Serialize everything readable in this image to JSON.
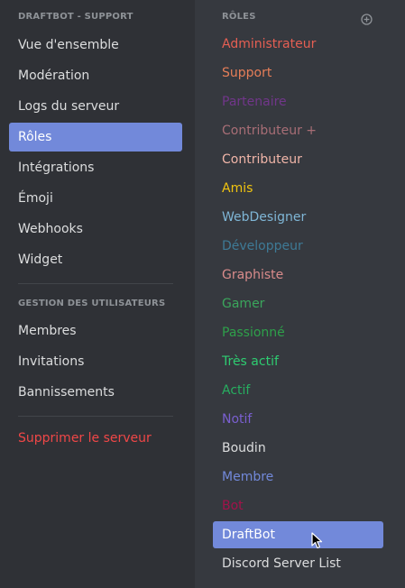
{
  "sidebar": {
    "server_header": "DRAFTBOT - SUPPORT",
    "items": [
      {
        "label": "Vue d'ensemble"
      },
      {
        "label": "Modération"
      },
      {
        "label": "Logs du serveur"
      },
      {
        "label": "Rôles"
      },
      {
        "label": "Intégrations"
      },
      {
        "label": "Émoji"
      },
      {
        "label": "Webhooks"
      },
      {
        "label": "Widget"
      }
    ],
    "users_header": "GESTION DES UTILISATEURS",
    "user_items": [
      {
        "label": "Membres"
      },
      {
        "label": "Invitations"
      },
      {
        "label": "Bannissements"
      }
    ],
    "delete_label": "Supprimer le serveur",
    "active_item": "Rôles"
  },
  "roles": {
    "header": "RÔLES",
    "add_icon": "plus-circle-icon",
    "selected": "DraftBot",
    "items": [
      {
        "name": "Administrateur",
        "color": "#e55f53"
      },
      {
        "name": "Support",
        "color": "#e67e58"
      },
      {
        "name": "Partenaire",
        "color": "#71368a"
      },
      {
        "name": "Contributeur +",
        "color": "#a86e76"
      },
      {
        "name": "Contributeur",
        "color": "#f0b5a8"
      },
      {
        "name": "Amis",
        "color": "#f1c40f"
      },
      {
        "name": "WebDesigner",
        "color": "#7fb6d6"
      },
      {
        "name": "Développeur",
        "color": "#3e7a96"
      },
      {
        "name": "Graphiste",
        "color": "#d98b8b"
      },
      {
        "name": "Gamer",
        "color": "#3ba55c"
      },
      {
        "name": "Passionné",
        "color": "#2ea04a"
      },
      {
        "name": "Très actif",
        "color": "#2ecc71"
      },
      {
        "name": "Actif",
        "color": "#27ae60"
      },
      {
        "name": "Notif",
        "color": "#7a5fd0"
      },
      {
        "name": "Boudin",
        "color": "#dcddde"
      },
      {
        "name": "Membre",
        "color": "#7289da"
      },
      {
        "name": "Bot",
        "color": "#a3124a"
      },
      {
        "name": "DraftBot",
        "color": "#ffffff"
      },
      {
        "name": "Discord Server List",
        "color": "#dcddde"
      }
    ]
  },
  "colors": {
    "sidebar_bg": "#2f3136",
    "main_bg": "#36393f",
    "accent": "#7289da",
    "danger": "#f04747"
  }
}
